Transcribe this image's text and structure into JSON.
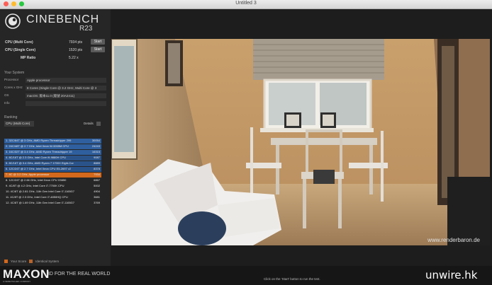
{
  "window": {
    "title": "Untitled 3"
  },
  "app": {
    "name": "CINEBENCH",
    "version": "R23"
  },
  "scores": [
    {
      "label": "CPU (Multi Core)",
      "value": "7934 pts",
      "button": "Start"
    },
    {
      "label": "CPU (Single Core)",
      "value": "1520 pts",
      "button": "Start"
    },
    {
      "label": "MP Ratio",
      "value": "5.22 x"
    }
  ],
  "system": {
    "title": "Your System",
    "fields": [
      {
        "key": "Processor",
        "value": "Apple processor"
      },
      {
        "key": "Cores x GHz",
        "value": "8 Cores (Single Core @ 3.2 GHz, Multi Core @ 3"
      },
      {
        "key": "OS",
        "value": "macOS: 版本11.0 (版號 20A2411)"
      },
      {
        "key": "Info",
        "value": ""
      }
    ]
  },
  "ranking": {
    "title": "Ranking",
    "selector": "CPU (Multi Core)",
    "details_label": "Details",
    "rows": [
      {
        "desc": "1. 32C/64T @ 3 GHz, AMD Ryzen Threadripper 299",
        "score": "30054",
        "style": "hl"
      },
      {
        "desc": "2. 24C/48T @ 2.7 GHz, Intel Xeon W-3265M CPU",
        "score": "24243",
        "style": "hl"
      },
      {
        "desc": "3. 16C/32T @ 3.4 GHz, AMD Ryzen Threadripper 19",
        "score": "16315",
        "style": "hl"
      },
      {
        "desc": "4. 8C/16T @ 2.3 GHz, Intel Core i9-9880H CPU",
        "score": "9087",
        "style": "hl2"
      },
      {
        "desc": "5. 8C/16T @ 3.4 GHz, AMD Ryzen 7 1700X Eight-Cor",
        "score": "8889",
        "style": "hl2"
      },
      {
        "desc": "6. 12C/24T @ 2.7 GHz, Intel Xeon CPU E5-2697 v2",
        "score": "8378",
        "style": "hl2"
      },
      {
        "desc": "7. 8C @ 3.2 GHz,                 Apple processor",
        "score": "7934",
        "style": "own"
      },
      {
        "desc": "8. 12C/24T @ 2.66 GHz, Intel Xeon CPU X5650",
        "score": "6867",
        "style": ""
      },
      {
        "desc": "9. 4C/8T @ 4.2 GHz, Intel Core i7-7700K CPU",
        "score": "5002",
        "style": ""
      },
      {
        "desc": "10. 4C/8T @ 2.81 GHz, 11th Gen Intel Core i7-1165G7",
        "score": "4904",
        "style": ""
      },
      {
        "desc": "11. 4C/8T @ 2.3 GHz, Intel Core i7-4850HQ CPU",
        "score": "3681",
        "style": ""
      },
      {
        "desc": "12. 4C/8T @ 1.69 GHz, 11th Gen Intel Core i7-1165G7",
        "score": "3769",
        "style": ""
      }
    ]
  },
  "legend": {
    "your_score": "Your Score",
    "identical": "Identical System"
  },
  "render": {
    "watermark": "www.renderbaron.de"
  },
  "footer": {
    "brand": "MAXON",
    "brand_sub": "A NEMETSCHEK COMPANY",
    "tagline": "3D FOR THE REAL WORLD",
    "hint": "Click on the 'Start' button to run the test."
  },
  "overlay": {
    "watermark": "unwire.hk"
  },
  "colors": {
    "highlight": "#2f5f9e",
    "own_score": "#d3691c",
    "identical": "#b8632a"
  }
}
